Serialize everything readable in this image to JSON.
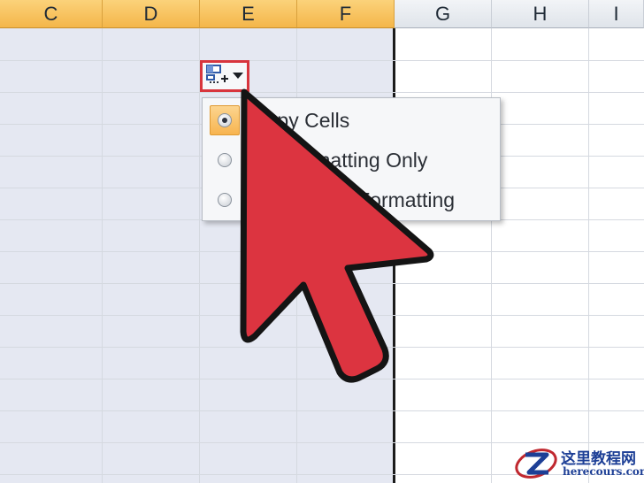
{
  "column_headers": [
    {
      "label": "C",
      "selected": true
    },
    {
      "label": "D",
      "selected": true
    },
    {
      "label": "E",
      "selected": true
    },
    {
      "label": "F",
      "selected": true
    },
    {
      "label": "G",
      "selected": false
    },
    {
      "label": "H",
      "selected": false
    },
    {
      "label": "I",
      "selected": false
    }
  ],
  "options_button": {
    "icon": "paste-options-icon",
    "dropdown_icon": "dropdown-arrow-icon"
  },
  "menu": {
    "items": [
      {
        "label": "Copy Cells",
        "visible_text": "Copy Cells",
        "checked": true
      },
      {
        "label": "Fill Formatting Only",
        "visible_text": "Fill Formatting Only",
        "checked": false
      },
      {
        "label": "Fill Without Formatting",
        "visible_text": "Fill Without Formatting",
        "checked": false
      }
    ]
  },
  "colors": {
    "selection_fill": "#e5e8f2",
    "header_selected": "#f4b64a",
    "highlight_border": "#d8353d",
    "cursor_fill": "#dc3440"
  },
  "watermark": {
    "text_cn": "这里教程网",
    "text_en": "herecours.com",
    "icon": "z-logo-icon"
  }
}
